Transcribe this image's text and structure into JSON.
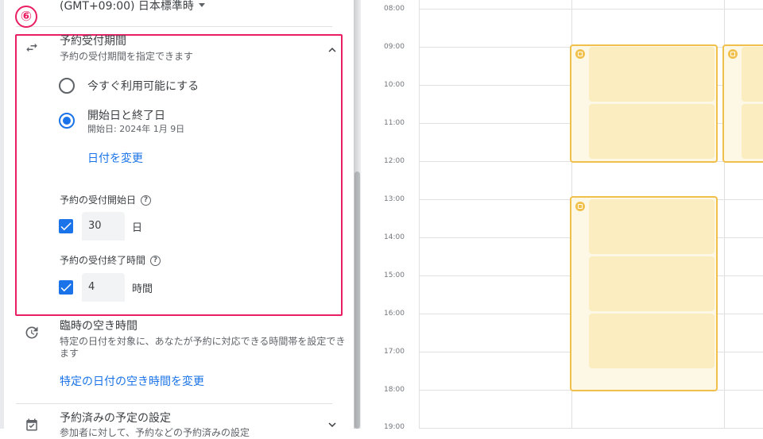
{
  "timezone": {
    "label": "(GMT+09:00) 日本標準時"
  },
  "step_marker": "⑥",
  "booking_window": {
    "title": "予約受付期間",
    "subtitle": "予約の受付期間を指定できます",
    "options": [
      {
        "label": "今すぐ利用可能にする",
        "selected": false
      },
      {
        "label": "開始日と終了日",
        "sub": "開始日: 2024年 1月 9日",
        "selected": true
      }
    ],
    "change_date_link": "日付を変更",
    "start_label": "予約の受付開始日",
    "start_value": "30",
    "start_unit": "日",
    "end_label": "予約の受付終了時間",
    "end_value": "4",
    "end_unit": "時間",
    "help_glyph": "?"
  },
  "temp_availability": {
    "title": "臨時の空き時間",
    "desc_line1": "特定の日付を対象に、あなたが予約に対応できる時間帯を設定でき",
    "desc_line2": "ます",
    "link": "特定の日付の空き時間を変更"
  },
  "booked_settings": {
    "title": "予約済みの予定の設定",
    "sub": "参加者に対して、予約などの予約済みの設定"
  },
  "calendar": {
    "times": [
      "08:00",
      "09:00",
      "10:00",
      "11:00",
      "12:00",
      "13:00",
      "14:00",
      "15:00",
      "16:00",
      "17:00",
      "18:00",
      "19:00"
    ],
    "accent": "#f0c04a"
  },
  "colors": {
    "highlight": "#e91e63",
    "link": "#1a73e8"
  }
}
